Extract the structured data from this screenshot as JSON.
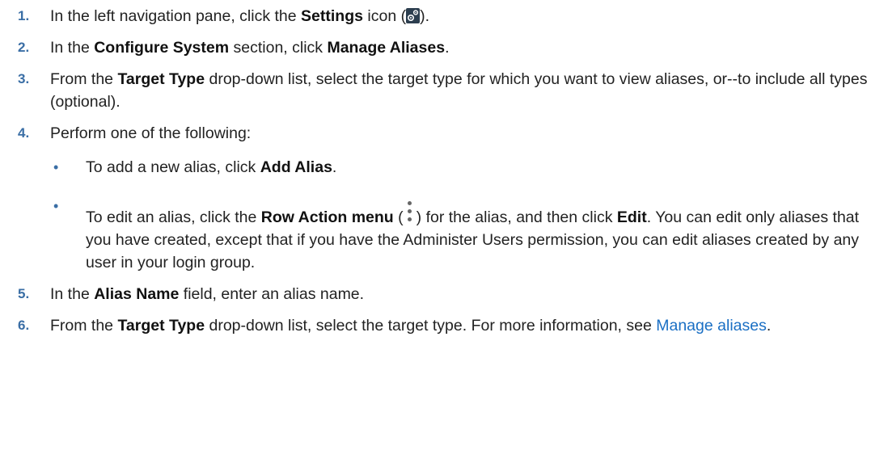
{
  "steps": [
    {
      "num": "1.",
      "t1": "In the left navigation pane, click the ",
      "b1": "Settings",
      "t2": " icon (",
      "t3": ")."
    },
    {
      "num": "2.",
      "t1": "In the ",
      "b1": "Configure System",
      "t2": " section, click ",
      "b2": "Manage Aliases",
      "t3": "."
    },
    {
      "num": "3.",
      "t1": "From the ",
      "b1": "Target Type",
      "t2": " drop-down list, select the target type for which you want to view aliases, or--to include all types (optional)."
    },
    {
      "num": "4.",
      "t1": "Perform one of the following:",
      "bullets": [
        {
          "t1": "To add a new alias, click ",
          "b1": "Add Alias",
          "t2": "."
        },
        {
          "t1": "To edit an alias, click the ",
          "b1": "Row Action menu",
          "t2": " (",
          "t3": ") for the alias, and then click ",
          "b2": "Edit",
          "t4": ". You can edit only aliases that you have created, except that if you have the Administer Users permission, you can edit aliases created by any user in your login group."
        }
      ]
    },
    {
      "num": "5.",
      "t1": "In the ",
      "b1": "Alias Name",
      "t2": " field, enter an alias name."
    },
    {
      "num": "6.",
      "t1": "From the ",
      "b1": "Target Type",
      "t2": " drop-down list, select the target type. For more information, see ",
      "link": "Manage aliases",
      "t3": "."
    }
  ],
  "bullet_glyph": "•",
  "icons": {
    "settings": "gear-icon",
    "row_action": "kebab-vertical-icon"
  },
  "colors": {
    "step_number": "#3a6ea5",
    "link": "#1a6fc4",
    "icon_bg": "#2c3e4f"
  }
}
